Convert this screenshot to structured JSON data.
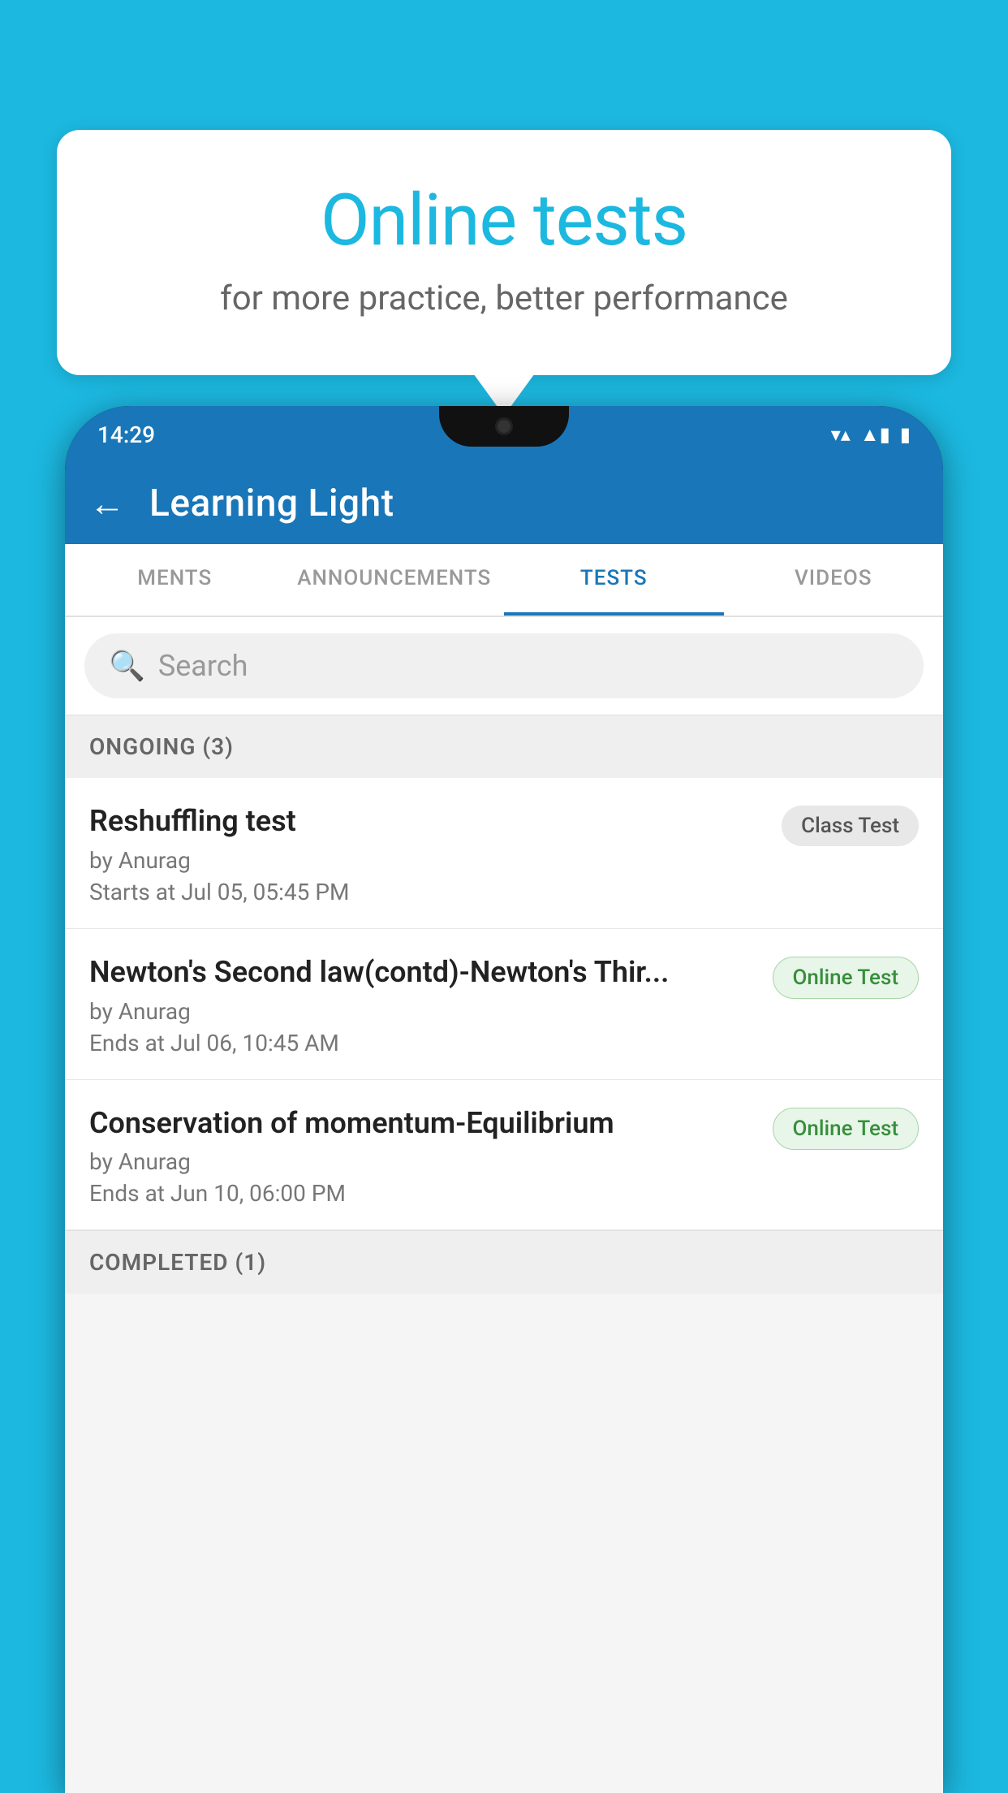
{
  "background": {
    "color": "#1cb8e0"
  },
  "speech_bubble": {
    "title": "Online tests",
    "subtitle": "for more practice, better performance"
  },
  "phone": {
    "status_bar": {
      "time": "14:29",
      "wifi": "▼▲",
      "battery": "▮"
    },
    "toolbar": {
      "title": "Learning Light",
      "back_label": "←"
    },
    "tabs": [
      {
        "label": "MENTS",
        "active": false
      },
      {
        "label": "ANNOUNCEMENTS",
        "active": false
      },
      {
        "label": "TESTS",
        "active": true
      },
      {
        "label": "VIDEOS",
        "active": false
      }
    ],
    "search": {
      "placeholder": "Search"
    },
    "ongoing_section": {
      "label": "ONGOING (3)"
    },
    "test_items": [
      {
        "name": "Reshuffling test",
        "author": "by Anurag",
        "time_label": "Starts at",
        "time": "Jul 05, 05:45 PM",
        "badge": "Class Test",
        "badge_type": "class"
      },
      {
        "name": "Newton's Second law(contd)-Newton's Thir...",
        "author": "by Anurag",
        "time_label": "Ends at",
        "time": "Jul 06, 10:45 AM",
        "badge": "Online Test",
        "badge_type": "online"
      },
      {
        "name": "Conservation of momentum-Equilibrium",
        "author": "by Anurag",
        "time_label": "Ends at",
        "time": "Jun 10, 06:00 PM",
        "badge": "Online Test",
        "badge_type": "online"
      }
    ],
    "completed_section": {
      "label": "COMPLETED (1)"
    }
  }
}
